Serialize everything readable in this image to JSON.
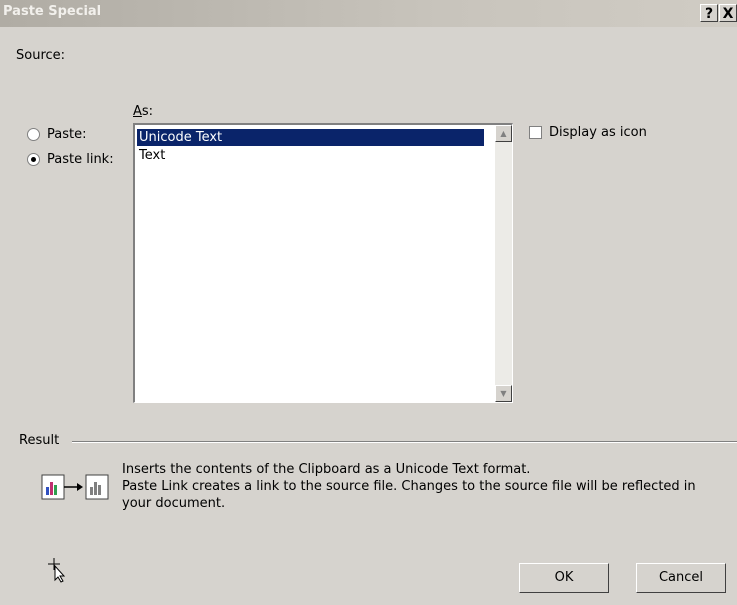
{
  "window": {
    "title": "Paste Special",
    "help_label": "?",
    "close_label": "X"
  },
  "source": {
    "label": "Source:"
  },
  "as": {
    "label": "As:"
  },
  "options": {
    "paste_label": "Paste:",
    "paste_link_label": "Paste link:",
    "selected": "paste_link"
  },
  "formats": [
    {
      "label": "Unicode Text",
      "selected": true
    },
    {
      "label": "Text",
      "selected": false
    }
  ],
  "display_as_icon": {
    "label": "Display as icon",
    "checked": false
  },
  "result": {
    "label": "Result",
    "line1": "Inserts the contents of the Clipboard as a Unicode Text format.",
    "line2": "Paste Link creates a link to the source file. Changes to the source file will be reflected in",
    "line3": "your document."
  },
  "buttons": {
    "ok": "OK",
    "cancel": "Cancel"
  },
  "colors": {
    "selection": "#0a246a",
    "face": "#d6d3ce"
  }
}
